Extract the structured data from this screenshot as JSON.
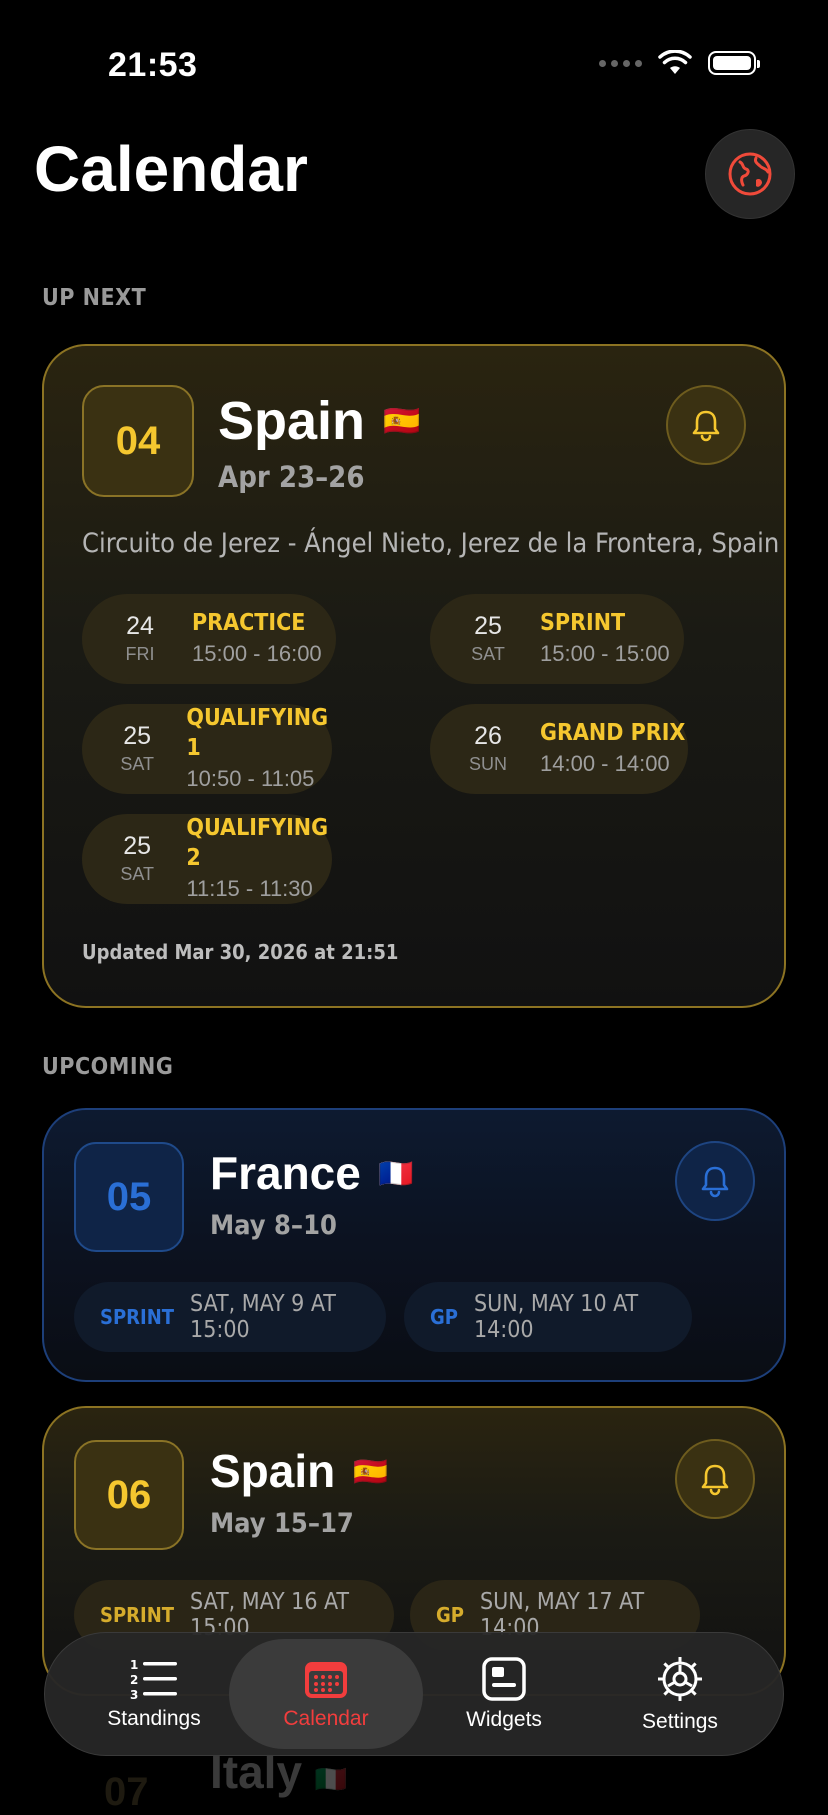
{
  "status": {
    "time": "21:53"
  },
  "header": {
    "title": "Calendar"
  },
  "sections": {
    "up_next": "UP NEXT",
    "upcoming": "UPCOMING"
  },
  "next_race": {
    "round": "04",
    "name": "Spain",
    "flag": "🇪🇸",
    "dates": "Apr 23–26",
    "circuit": "Circuito de Jerez - Ángel Nieto, Jerez de la Frontera, Spain",
    "sessions": [
      {
        "day": "24",
        "dow": "FRI",
        "name": "PRACTICE",
        "time": "15:00 - 16:00"
      },
      {
        "day": "25",
        "dow": "SAT",
        "name": "SPRINT",
        "time": "15:00 - 15:00"
      },
      {
        "day": "25",
        "dow": "SAT",
        "name": "QUALIFYING 1",
        "time": "10:50 - 11:05"
      },
      {
        "day": "26",
        "dow": "SUN",
        "name": "GRAND PRIX",
        "time": "14:00 - 14:00"
      },
      {
        "day": "25",
        "dow": "SAT",
        "name": "QUALIFYING 2",
        "time": "11:15 - 11:30"
      }
    ],
    "updated": "Updated Mar 30, 2026 at 21:51"
  },
  "upcoming": [
    {
      "round": "05",
      "name": "France",
      "flag": "🇫🇷",
      "dates": "May 8–10",
      "sprint_tag": "SPRINT",
      "sprint": "SAT, MAY 9 AT 15:00",
      "gp_tag": "GP",
      "gp": "SUN, MAY 10 AT 14:00"
    },
    {
      "round": "06",
      "name": "Spain",
      "flag": "🇪🇸",
      "dates": "May 15–17",
      "sprint_tag": "SPRINT",
      "sprint": "SAT, MAY 16 AT 15:00",
      "gp_tag": "GP",
      "gp": "SUN, MAY 17 AT 14:00"
    },
    {
      "round": "07",
      "name": "Italy",
      "flag": "🇮🇹"
    }
  ],
  "tabs": [
    {
      "label": "Standings",
      "icon": "list-numbered-icon"
    },
    {
      "label": "Calendar",
      "icon": "calendar-icon",
      "active": true
    },
    {
      "label": "Widgets",
      "icon": "widget-icon"
    },
    {
      "label": "Settings",
      "icon": "gear-icon"
    }
  ],
  "colors": {
    "gold": "#f5c72f",
    "blue": "#2a6fd6",
    "active_tab": "#f23d3d",
    "globe": "#f04a3a"
  }
}
